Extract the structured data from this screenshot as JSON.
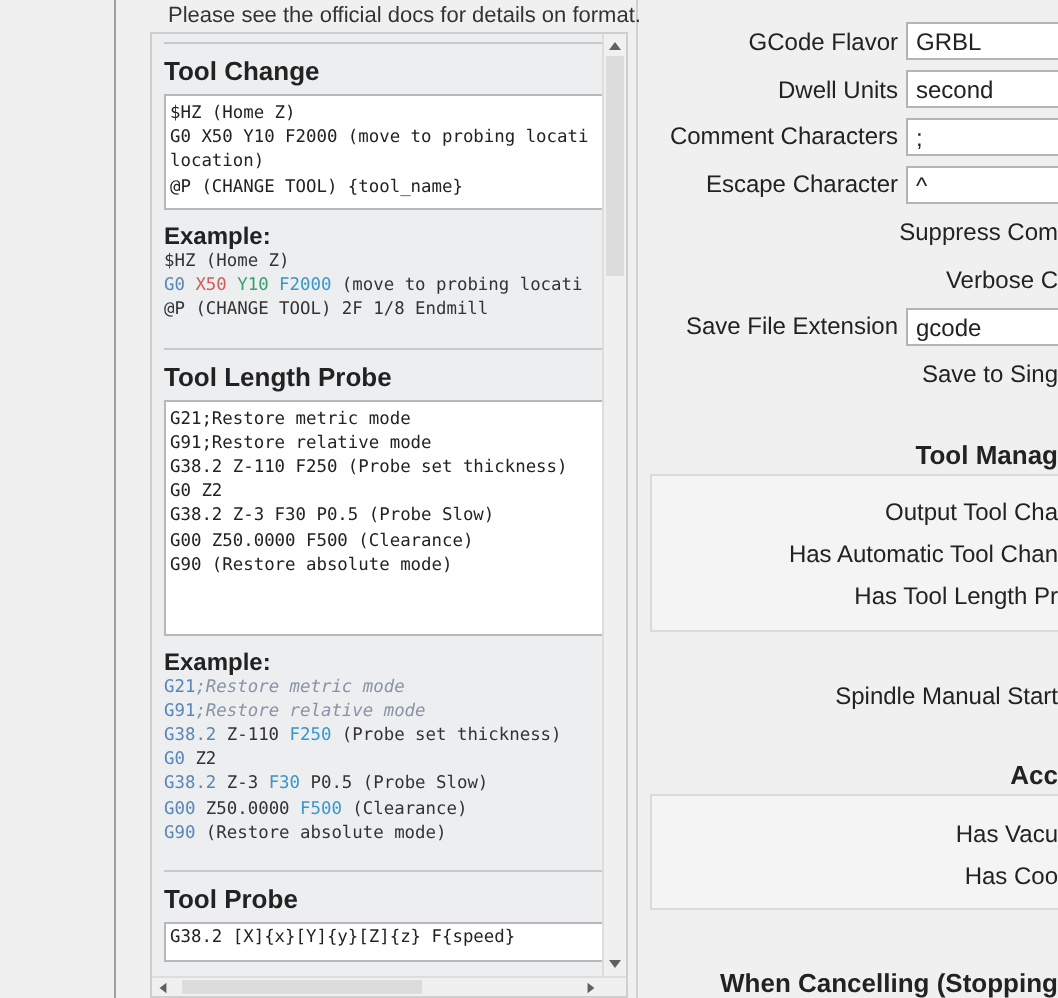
{
  "note": "Please see the official docs for details on format.",
  "sections": [
    {
      "title": "Tool Change",
      "lines": [
        "$HZ (Home Z)",
        "G0 X50 Y10 F2000 (move to probing locati",
        "location)",
        "@P (CHANGE TOOL) {tool_name}"
      ],
      "example_label": "Example:",
      "example": [
        [
          {
            "text": "$HZ (Home Z)",
            "kind": "plain"
          }
        ],
        [
          {
            "text": "G0 ",
            "kind": "cmd"
          },
          {
            "text": "X50 ",
            "kind": "x"
          },
          {
            "text": "Y10 ",
            "kind": "y"
          },
          {
            "text": "F2000",
            "kind": "param"
          },
          {
            "text": " (move to probing locati",
            "kind": "plain"
          }
        ],
        [
          {
            "text": "@P (CHANGE TOOL) 2F 1/8 Endmill",
            "kind": "plain"
          }
        ]
      ]
    },
    {
      "title": "Tool Length Probe",
      "lines": [
        "G21;Restore metric mode",
        "G91;Restore relative mode",
        "G38.2 Z-110 F250 (Probe set thickness)",
        "G0 Z2",
        "G38.2 Z-3 F30 P0.5 (Probe Slow)",
        "G00 Z50.0000 F500 (Clearance)",
        "G90 (Restore absolute mode)"
      ],
      "example_label": "Example:",
      "example": [
        [
          {
            "text": "G21",
            "kind": "cmd"
          },
          {
            "text": ";Restore metric mode",
            "kind": "comment"
          }
        ],
        [
          {
            "text": "G91",
            "kind": "cmd"
          },
          {
            "text": ";Restore relative mode",
            "kind": "comment"
          }
        ],
        [
          {
            "text": "G38.2",
            "kind": "cmd"
          },
          {
            "text": " Z-110 ",
            "kind": "plain"
          },
          {
            "text": "F250",
            "kind": "param"
          },
          {
            "text": " (Probe set thickness)",
            "kind": "plain"
          }
        ],
        [
          {
            "text": "G0",
            "kind": "cmd"
          },
          {
            "text": " Z2",
            "kind": "plain"
          }
        ],
        [
          {
            "text": "G38.2",
            "kind": "cmd"
          },
          {
            "text": " Z-3 ",
            "kind": "plain"
          },
          {
            "text": "F30",
            "kind": "param"
          },
          {
            "text": " P0.5 (Probe Slow)",
            "kind": "plain"
          }
        ],
        [
          {
            "text": "G00",
            "kind": "cmd"
          },
          {
            "text": " Z50.0000 ",
            "kind": "plain"
          },
          {
            "text": "F500",
            "kind": "param"
          },
          {
            "text": " (Clearance)",
            "kind": "plain"
          }
        ],
        [
          {
            "text": "G90",
            "kind": "cmd"
          },
          {
            "text": " (Restore absolute mode)",
            "kind": "plain"
          }
        ]
      ]
    },
    {
      "title": "Tool Probe",
      "lines": [
        "G38.2 [X]{x}[Y]{y}[Z]{z} F{speed}"
      ]
    }
  ],
  "settings": [
    {
      "kind": "select",
      "label": "GCode Flavor",
      "value": "GRBL"
    },
    {
      "kind": "select",
      "label": "Dwell Units",
      "value": "second"
    },
    {
      "kind": "input",
      "label": "Comment Characters",
      "value": ";"
    },
    {
      "kind": "input",
      "label": "Escape Character",
      "value": "^"
    },
    {
      "kind": "text",
      "label": "Suppress Com"
    },
    {
      "kind": "text",
      "label": "Verbose C"
    },
    {
      "kind": "input",
      "label": "Save File Extension",
      "value": "gcode"
    },
    {
      "kind": "text",
      "label": "Save to Sing"
    },
    {
      "kind": "heading",
      "label": "Tool Manag"
    },
    {
      "kind": "group",
      "items": [
        "Output Tool Cha",
        "Has Automatic Tool Chan",
        "Has Tool Length Pr"
      ]
    },
    {
      "kind": "text",
      "label": "Spindle Manual Start"
    },
    {
      "kind": "heading",
      "label": "Acc"
    },
    {
      "kind": "group",
      "items": [
        "Has Vacu",
        "Has Coo"
      ]
    },
    {
      "kind": "heading",
      "label": "When Cancelling (Stopping"
    }
  ]
}
